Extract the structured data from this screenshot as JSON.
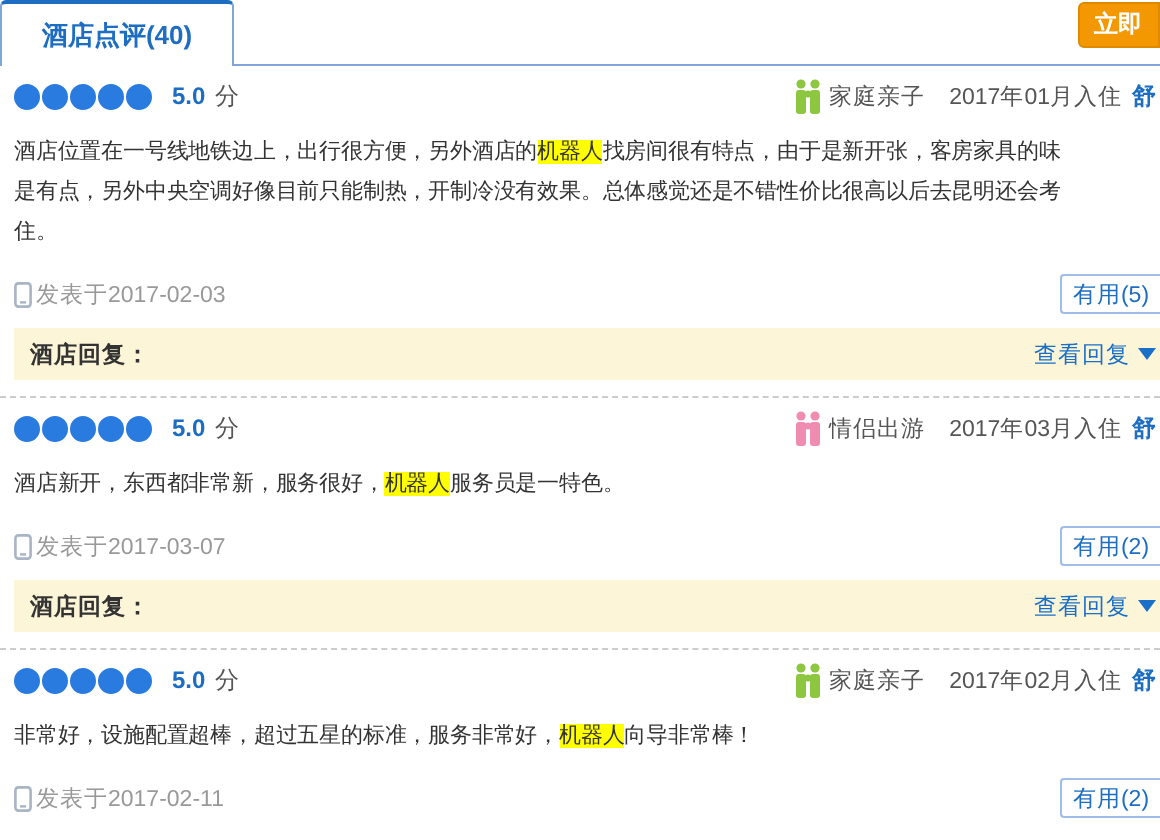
{
  "tabs": [
    {
      "label": "酒店点评(40)",
      "selected": true
    }
  ],
  "book_button": "立即",
  "reviews": [
    {
      "stars": 5,
      "score": "5.0",
      "score_unit": "分",
      "trip": {
        "kind": "family",
        "label": "家庭亲子"
      },
      "stay": "2017年01月入住",
      "tag": "舒",
      "lines": [
        [
          {
            "text": "酒店位置在一号线地铁边上，出行很方便，另外酒店的",
            "highlight": false
          },
          {
            "text": "机器人",
            "highlight": true
          },
          {
            "text": "找房间很有特点，由于是新开张，客房家具的味",
            "highlight": false
          }
        ],
        [
          {
            "text": "是有点，另外中央空调好像目前只能制热，开制冷没有效果。总体感觉还是不错性价比很高以后去昆明还会考",
            "highlight": false
          }
        ],
        [
          {
            "text": "住。",
            "highlight": false
          }
        ]
      ],
      "posted": "发表于2017-02-03",
      "useful": "有用(5)",
      "reply": {
        "label": "酒店回复：",
        "link": "查看回复"
      }
    },
    {
      "stars": 5,
      "score": "5.0",
      "score_unit": "分",
      "trip": {
        "kind": "couple",
        "label": "情侣出游"
      },
      "stay": "2017年03月入住",
      "tag": "舒",
      "lines": [
        [
          {
            "text": "酒店新开，东西都非常新，服务很好，",
            "highlight": false
          },
          {
            "text": "机器人",
            "highlight": true
          },
          {
            "text": "服务员是一特色。",
            "highlight": false
          }
        ]
      ],
      "posted": "发表于2017-03-07",
      "useful": "有用(2)",
      "reply": {
        "label": "酒店回复：",
        "link": "查看回复"
      }
    },
    {
      "stars": 5,
      "score": "5.0",
      "score_unit": "分",
      "trip": {
        "kind": "family",
        "label": "家庭亲子"
      },
      "stay": "2017年02月入住",
      "tag": "舒",
      "lines": [
        [
          {
            "text": "非常好，设施配置超棒，超过五星的标准，服务非常好，",
            "highlight": false
          },
          {
            "text": "机器人",
            "highlight": true
          },
          {
            "text": "向导非常棒！",
            "highlight": false
          }
        ]
      ],
      "posted": "发表于2017-02-11",
      "useful": "有用(2)"
    }
  ]
}
